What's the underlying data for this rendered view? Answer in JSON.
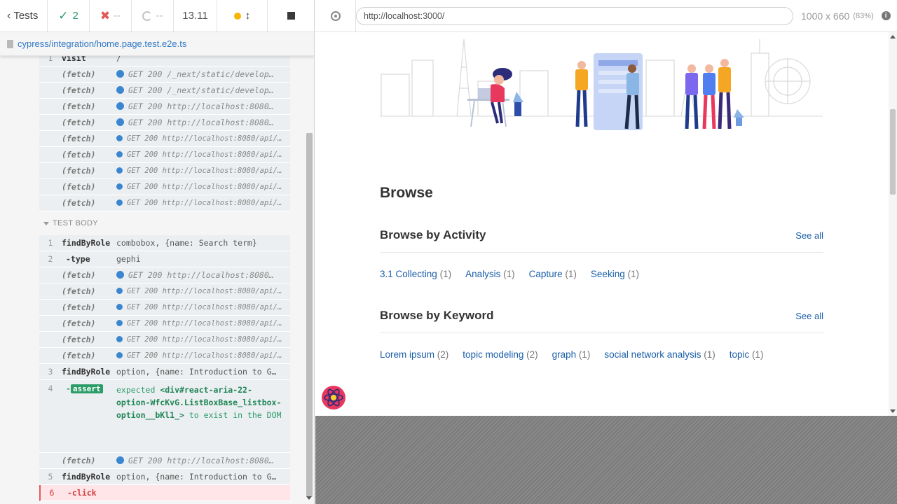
{
  "colors": {
    "passed": "#2a9d69",
    "failed": "#e05a5a",
    "running": "#f6b500",
    "link": "#1a5ea8",
    "fetch_dot": "#3b86d0"
  },
  "reporter": {
    "stats": {
      "tests_label": "Tests",
      "passed": "2",
      "failed": "--",
      "pending": "--",
      "duration": "13.11"
    },
    "spec_file": "cypress/integration/home.page.test.e2e.ts",
    "test_body_label": "TEST BODY",
    "hooks": [
      {
        "num": "1",
        "name": "visit",
        "msg": "/",
        "type": "cmd"
      },
      {
        "num": "",
        "name": "(fetch)",
        "msg": "GET 200 /_next/static/develop…",
        "type": "fetch"
      },
      {
        "num": "",
        "name": "(fetch)",
        "msg": "GET 200 /_next/static/develop…",
        "type": "fetch"
      },
      {
        "num": "",
        "name": "(fetch)",
        "msg": "GET 200 http://localhost:8080…",
        "type": "fetch"
      },
      {
        "num": "",
        "name": "(fetch)",
        "msg": "GET 200 http://localhost:8080…",
        "type": "fetch"
      },
      {
        "num": "",
        "name": "(fetch)",
        "msg": "GET 200 http://localhost:8080/api/i…",
        "type": "fetch-small"
      },
      {
        "num": "",
        "name": "(fetch)",
        "msg": "GET 200 http://localhost:8080/api/i…",
        "type": "fetch-small"
      },
      {
        "num": "",
        "name": "(fetch)",
        "msg": "GET 200 http://localhost:8080/api/i…",
        "type": "fetch-small"
      },
      {
        "num": "",
        "name": "(fetch)",
        "msg": "GET 200 http://localhost:8080/api/i…",
        "type": "fetch-small"
      },
      {
        "num": "",
        "name": "(fetch)",
        "msg": "GET 200 http://localhost:8080/api/i…",
        "type": "fetch-small"
      }
    ],
    "body": [
      {
        "num": "1",
        "name": "findByRole",
        "msg": "combobox, {name: Search term}",
        "type": "cmd"
      },
      {
        "num": "2",
        "name": "-type",
        "msg": "gephi",
        "type": "child"
      },
      {
        "num": "",
        "name": "(fetch)",
        "msg": "GET 200 http://localhost:8080…",
        "type": "fetch"
      },
      {
        "num": "",
        "name": "(fetch)",
        "msg": "GET 200 http://localhost:8080/api/i…",
        "type": "fetch-small"
      },
      {
        "num": "",
        "name": "(fetch)",
        "msg": "GET 200 http://localhost:8080/api/i…",
        "type": "fetch-small"
      },
      {
        "num": "",
        "name": "(fetch)",
        "msg": "GET 200 http://localhost:8080/api/i…",
        "type": "fetch-small"
      },
      {
        "num": "",
        "name": "(fetch)",
        "msg": "GET 200 http://localhost:8080/api/i…",
        "type": "fetch-small"
      },
      {
        "num": "",
        "name": "(fetch)",
        "msg": "GET 200 http://localhost:8080/api/i…",
        "type": "fetch-small"
      },
      {
        "num": "3",
        "name": "findByRole",
        "msg": "option, {name: Introduction to G…",
        "type": "cmd"
      }
    ],
    "assert": {
      "num": "4",
      "name_prefix": "-",
      "badge": "assert",
      "expected": "expected",
      "value": "<div#react-aria-22-option-WfcKvG.ListBoxBase_listbox-option__bKl1_>",
      "tail": "to exist in the DOM"
    },
    "tail": [
      {
        "num": "",
        "name": "(fetch)",
        "msg": "GET 200 http://localhost:8080…",
        "type": "fetch"
      },
      {
        "num": "5",
        "name": "findByRole",
        "msg": "option, {name: Introduction to G…",
        "type": "cmd"
      },
      {
        "num": "6",
        "name": "-click",
        "msg": "",
        "type": "failed"
      }
    ]
  },
  "aut": {
    "url": "http://localhost:3000/",
    "viewport_size": "1000 x 660",
    "zoom": "(83%)",
    "info_glyph": "i",
    "browse_title": "Browse",
    "activity": {
      "title": "Browse by Activity",
      "see_all": "See all",
      "tags": [
        {
          "label": "3.1 Collecting",
          "count": "(1)"
        },
        {
          "label": "Analysis",
          "count": "(1)"
        },
        {
          "label": "Capture",
          "count": "(1)"
        },
        {
          "label": "Seeking",
          "count": "(1)"
        }
      ]
    },
    "keyword": {
      "title": "Browse by Keyword",
      "see_all": "See all",
      "tags": [
        {
          "label": "Lorem ipsum",
          "count": "(2)"
        },
        {
          "label": "topic modeling",
          "count": "(2)"
        },
        {
          "label": "graph",
          "count": "(1)"
        },
        {
          "label": "social network analysis",
          "count": "(1)"
        },
        {
          "label": "topic",
          "count": "(1)"
        }
      ]
    }
  }
}
